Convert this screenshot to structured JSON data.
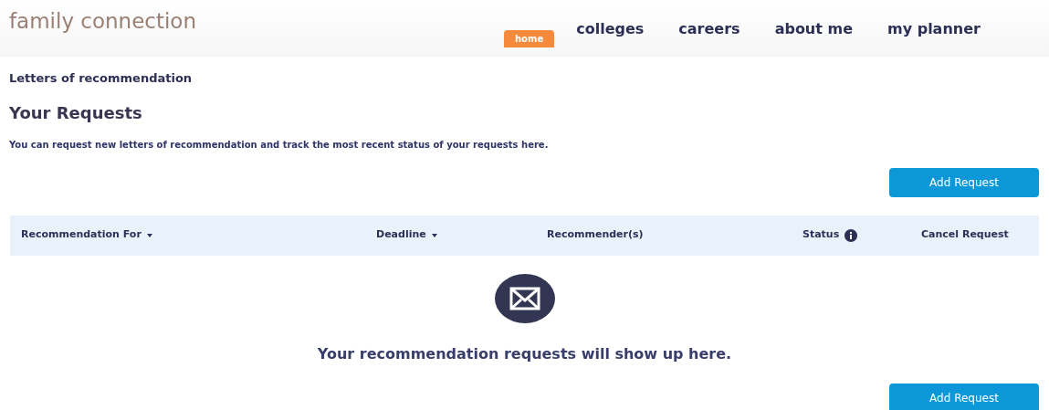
{
  "logo": "family connection",
  "nav": [
    {
      "label": "home",
      "selected": true
    },
    {
      "label": "colleges",
      "selected": false
    },
    {
      "label": "careers",
      "selected": false
    },
    {
      "label": "about me",
      "selected": false
    },
    {
      "label": "my planner",
      "selected": false
    }
  ],
  "breadcrumb": "Letters of recommendation",
  "heading": "Your Requests",
  "intro": "You can request new letters of recommendation and track the most recent status of your requests here.",
  "add_button_top": "Add Request",
  "table": {
    "columns": [
      {
        "label": "Recommendation For",
        "sortable": true,
        "info": false
      },
      {
        "label": "Deadline",
        "sortable": true,
        "info": false
      },
      {
        "label": "Recommender(s)",
        "sortable": false,
        "info": false
      },
      {
        "label": "Status",
        "sortable": false,
        "info": true
      },
      {
        "label": "Cancel Request",
        "sortable": false,
        "info": false
      }
    ]
  },
  "empty_message": "Your recommendation requests will show up here.",
  "add_button_bottom": "Add Request"
}
